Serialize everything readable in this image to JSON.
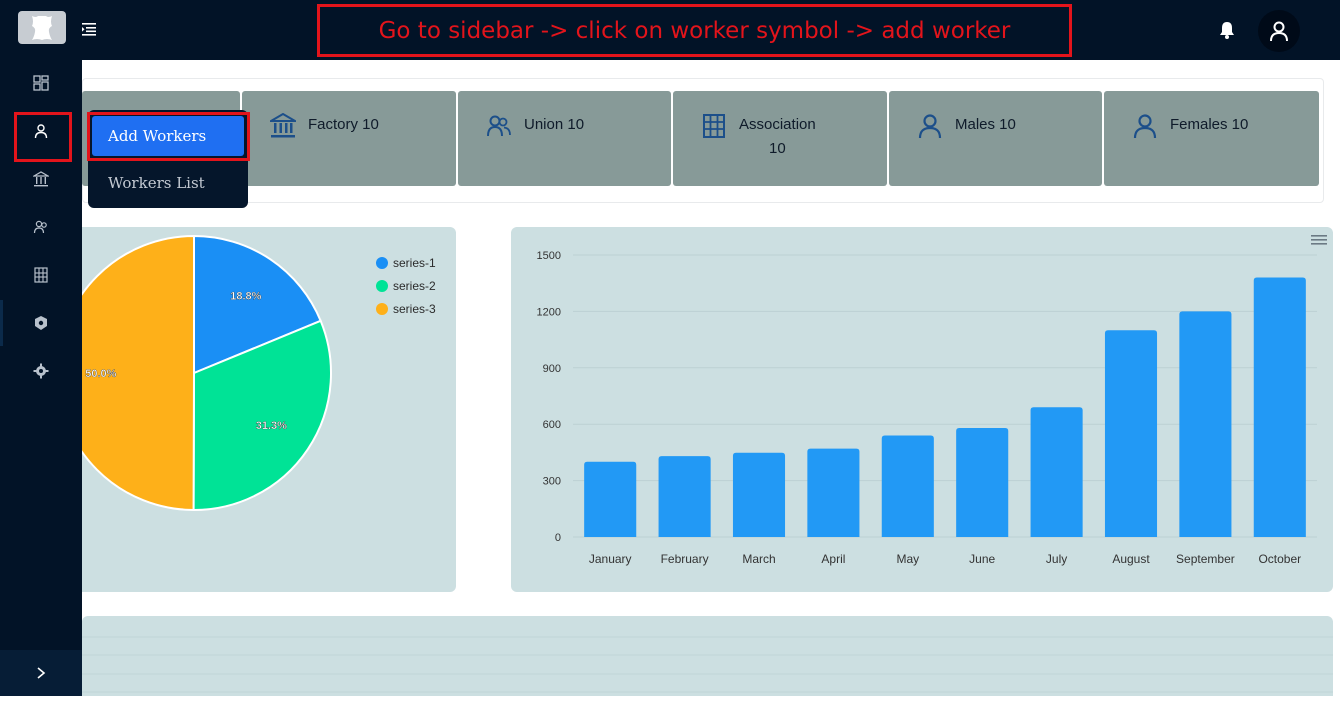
{
  "banner": {
    "text": "Go to sidebar -> click on worker symbol -> add worker"
  },
  "icons": {
    "logo": "leather-hide-logo",
    "menu": "menu-toggle-icon",
    "bell": "bell-icon",
    "avatar": "user-icon",
    "sidebar": [
      "dashboard-icon",
      "worker-icon",
      "factory-icon",
      "union-icon",
      "association-icon",
      "badge-icon",
      "gear-icon"
    ],
    "expand": "chevron-right-icon"
  },
  "dropdown": {
    "add_label": "Add Workers",
    "list_label": "Workers List"
  },
  "stats": [
    {
      "label": "Factory 10",
      "icon": "bank-icon"
    },
    {
      "label": "Union 10",
      "icon": "users-icon"
    },
    {
      "label": "Association",
      "sub": "10",
      "icon": "building-icon"
    },
    {
      "label": "Males 10",
      "icon": "person-icon"
    },
    {
      "label": "Females 10",
      "icon": "person-icon"
    }
  ],
  "colors": {
    "accent_red": "#e3141b",
    "brand_dark": "#021327",
    "card_bg": "#ccdfe1",
    "stat_bg": "#879a98",
    "icon_blue": "#1c4f8a",
    "bar_blue": "#2299f5"
  },
  "chart_data": [
    {
      "type": "pie",
      "series": [
        {
          "name": "series-1",
          "value": 18.8,
          "label": "18.8%",
          "color": "#1a8ff5"
        },
        {
          "name": "series-2",
          "value": 31.3,
          "label": "31.3%",
          "color": "#00e396"
        },
        {
          "name": "series-3",
          "value": 50.0,
          "label": "50.0%",
          "color": "#feb019"
        }
      ],
      "legend": "top-right"
    },
    {
      "type": "bar",
      "categories": [
        "January",
        "February",
        "March",
        "April",
        "May",
        "June",
        "July",
        "August",
        "September",
        "October"
      ],
      "values": [
        400,
        430,
        448,
        470,
        540,
        580,
        690,
        1100,
        1200,
        1380
      ],
      "yticks": [
        "0",
        "300",
        "600",
        "900",
        "1200",
        "1500"
      ],
      "ylim": [
        0,
        1500
      ],
      "grid": true,
      "color": "#2299f5"
    }
  ]
}
